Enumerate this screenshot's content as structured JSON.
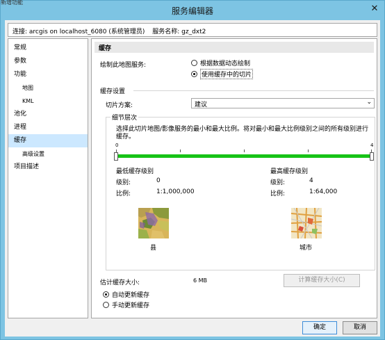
{
  "window": {
    "title": "服务编辑器",
    "close_glyph": "✕",
    "top_overlay_text": "新增功能"
  },
  "connection": {
    "conn_text": "连接: arcgis on localhost_6080 (系统管理员)",
    "service_text": "服务名称: gz_dxt2"
  },
  "nav": {
    "items": [
      {
        "label": "常规"
      },
      {
        "label": "参数"
      },
      {
        "label": "功能"
      },
      {
        "label": "地图"
      },
      {
        "label": "KML"
      },
      {
        "label": "池化"
      },
      {
        "label": "进程"
      },
      {
        "label": "缓存"
      },
      {
        "label": "高级设置"
      },
      {
        "label": "项目描述"
      }
    ]
  },
  "cache": {
    "header": "缓存",
    "draw_label": "绘制此地图服务:",
    "draw_options": [
      "根据数据动态绘制",
      "使用缓存中的切片"
    ],
    "draw_selected": "使用缓存中的切片",
    "settings_label": "缓存设置",
    "scheme_label": "切片方案:",
    "scheme_value": "建议",
    "lod_legend": "细节层次",
    "lod_desc": "选择此切片地图/影像服务的最小和最大比例。将对最小和最大比例级别之间的所有级别进行缓存。",
    "slider_min_label": "0",
    "slider_max_label": "4",
    "slider_min": 0,
    "slider_max": 4,
    "min_title": "最低缓存级别",
    "min_level_label": "级别:",
    "min_level": "0",
    "min_scale_label": "比例:",
    "min_scale": "1:1,000,000",
    "min_map_caption": "县",
    "max_title": "最高缓存级别",
    "max_level_label": "级别:",
    "max_level": "4",
    "max_scale_label": "比例:",
    "max_scale": "1:64,000",
    "max_map_caption": "城市",
    "est_label": "估计缓存大小:",
    "est_value": "6 MB",
    "calc_button": "计算缓存大小(C)",
    "update_options": [
      "自动更新缓存",
      "手动更新缓存"
    ],
    "update_selected": "自动更新缓存"
  },
  "footer": {
    "ok": "确定",
    "cancel": "取消"
  }
}
